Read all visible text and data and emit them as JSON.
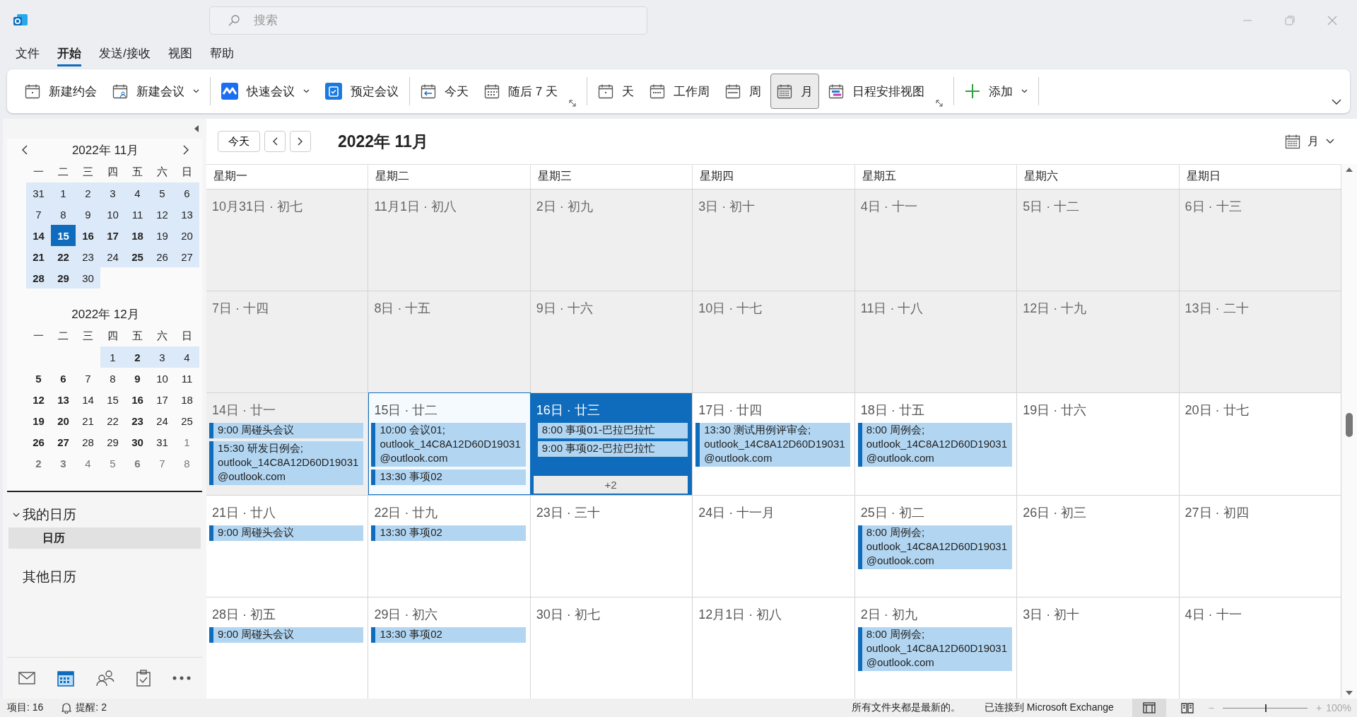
{
  "search": {
    "placeholder": "搜索"
  },
  "menu_tabs": [
    {
      "label": "文件",
      "selected": false
    },
    {
      "label": "开始",
      "selected": true
    },
    {
      "label": "发送/接收",
      "selected": false
    },
    {
      "label": "视图",
      "selected": false
    },
    {
      "label": "帮助",
      "selected": false
    }
  ],
  "ribbon": {
    "groups": [
      [
        {
          "kind": "appointment",
          "label": "新建约会",
          "has_menu": false,
          "launcher": false,
          "selected": false
        },
        {
          "kind": "meeting",
          "label": "新建会议",
          "has_menu": true,
          "launcher": false,
          "selected": false
        }
      ],
      [
        {
          "kind": "quickmeet",
          "label": "快速会议",
          "has_menu": true,
          "launcher": false,
          "selected": false
        },
        {
          "kind": "booking",
          "label": "预定会议",
          "has_menu": false,
          "launcher": false,
          "selected": false
        }
      ],
      [
        {
          "kind": "today",
          "label": "今天",
          "has_menu": false,
          "launcher": false,
          "selected": false
        },
        {
          "kind": "next7",
          "label": "随后 7 天",
          "has_menu": false,
          "launcher": true,
          "selected": false
        }
      ],
      [
        {
          "kind": "day",
          "label": "天",
          "has_menu": false,
          "launcher": false,
          "selected": false
        },
        {
          "kind": "workweek",
          "label": "工作周",
          "has_menu": false,
          "launcher": false,
          "selected": false
        },
        {
          "kind": "week",
          "label": "周",
          "has_menu": false,
          "launcher": false,
          "selected": false
        },
        {
          "kind": "month",
          "label": "月",
          "has_menu": false,
          "launcher": false,
          "selected": true
        },
        {
          "kind": "schedule",
          "label": "日程安排视图",
          "has_menu": false,
          "launcher": true,
          "selected": false
        }
      ],
      [
        {
          "kind": "add",
          "label": "添加",
          "has_menu": true,
          "launcher": false,
          "selected": false
        }
      ]
    ]
  },
  "mini_calendars": [
    {
      "title": "2022年 11月",
      "weekdays": [
        "一",
        "二",
        "三",
        "四",
        "五",
        "六",
        "日"
      ],
      "weeks": [
        [
          {
            "label": "31",
            "bold": false,
            "highlighted": true,
            "selected": false,
            "muted": false
          },
          {
            "label": "1",
            "bold": false,
            "highlighted": true,
            "selected": false,
            "muted": false
          },
          {
            "label": "2",
            "bold": false,
            "highlighted": true,
            "selected": false,
            "muted": false
          },
          {
            "label": "3",
            "bold": false,
            "highlighted": true,
            "selected": false,
            "muted": false
          },
          {
            "label": "4",
            "bold": false,
            "highlighted": true,
            "selected": false,
            "muted": false
          },
          {
            "label": "5",
            "bold": false,
            "highlighted": true,
            "selected": false,
            "muted": false
          },
          {
            "label": "6",
            "bold": false,
            "highlighted": true,
            "selected": false,
            "muted": false
          }
        ],
        [
          {
            "label": "7",
            "bold": false,
            "highlighted": true,
            "selected": false,
            "muted": false
          },
          {
            "label": "8",
            "bold": false,
            "highlighted": true,
            "selected": false,
            "muted": false
          },
          {
            "label": "9",
            "bold": false,
            "highlighted": true,
            "selected": false,
            "muted": false
          },
          {
            "label": "10",
            "bold": false,
            "highlighted": true,
            "selected": false,
            "muted": false
          },
          {
            "label": "11",
            "bold": false,
            "highlighted": true,
            "selected": false,
            "muted": false
          },
          {
            "label": "12",
            "bold": false,
            "highlighted": true,
            "selected": false,
            "muted": false
          },
          {
            "label": "13",
            "bold": false,
            "highlighted": true,
            "selected": false,
            "muted": false
          }
        ],
        [
          {
            "label": "14",
            "bold": true,
            "highlighted": true,
            "selected": false,
            "muted": false
          },
          {
            "label": "15",
            "bold": true,
            "highlighted": true,
            "selected": true,
            "muted": false
          },
          {
            "label": "16",
            "bold": true,
            "highlighted": true,
            "selected": false,
            "muted": false
          },
          {
            "label": "17",
            "bold": true,
            "highlighted": true,
            "selected": false,
            "muted": false
          },
          {
            "label": "18",
            "bold": true,
            "highlighted": true,
            "selected": false,
            "muted": false
          },
          {
            "label": "19",
            "bold": false,
            "highlighted": true,
            "selected": false,
            "muted": false
          },
          {
            "label": "20",
            "bold": false,
            "highlighted": true,
            "selected": false,
            "muted": false
          }
        ],
        [
          {
            "label": "21",
            "bold": true,
            "highlighted": true,
            "selected": false,
            "muted": false
          },
          {
            "label": "22",
            "bold": true,
            "highlighted": true,
            "selected": false,
            "muted": false
          },
          {
            "label": "23",
            "bold": false,
            "highlighted": true,
            "selected": false,
            "muted": false
          },
          {
            "label": "24",
            "bold": false,
            "highlighted": true,
            "selected": false,
            "muted": false
          },
          {
            "label": "25",
            "bold": true,
            "highlighted": true,
            "selected": false,
            "muted": false
          },
          {
            "label": "26",
            "bold": false,
            "highlighted": true,
            "selected": false,
            "muted": false
          },
          {
            "label": "27",
            "bold": false,
            "highlighted": true,
            "selected": false,
            "muted": false
          }
        ],
        [
          {
            "label": "28",
            "bold": true,
            "highlighted": true,
            "selected": false,
            "muted": false
          },
          {
            "label": "29",
            "bold": true,
            "highlighted": true,
            "selected": false,
            "muted": false
          },
          {
            "label": "30",
            "bold": false,
            "highlighted": true,
            "selected": false,
            "muted": false
          }
        ]
      ]
    },
    {
      "title": "2022年 12月",
      "weekdays": [
        "一",
        "二",
        "三",
        "四",
        "五",
        "六",
        "日"
      ],
      "weeks": [
        [
          {
            "label": "1",
            "bold": false,
            "highlighted": true,
            "selected": false,
            "muted": false
          },
          {
            "label": "2",
            "bold": true,
            "highlighted": true,
            "selected": false,
            "muted": false
          },
          {
            "label": "3",
            "bold": false,
            "highlighted": true,
            "selected": false,
            "muted": false
          },
          {
            "label": "4",
            "bold": false,
            "highlighted": true,
            "selected": false,
            "muted": false
          }
        ],
        [
          {
            "label": "5",
            "bold": true,
            "highlighted": false,
            "selected": false,
            "muted": false
          },
          {
            "label": "6",
            "bold": true,
            "highlighted": false,
            "selected": false,
            "muted": false
          },
          {
            "label": "7",
            "bold": false,
            "highlighted": false,
            "selected": false,
            "muted": false
          },
          {
            "label": "8",
            "bold": false,
            "highlighted": false,
            "selected": false,
            "muted": false
          },
          {
            "label": "9",
            "bold": true,
            "highlighted": false,
            "selected": false,
            "muted": false
          },
          {
            "label": "10",
            "bold": false,
            "highlighted": false,
            "selected": false,
            "muted": false
          },
          {
            "label": "11",
            "bold": false,
            "highlighted": false,
            "selected": false,
            "muted": false
          }
        ],
        [
          {
            "label": "12",
            "bold": true,
            "highlighted": false,
            "selected": false,
            "muted": false
          },
          {
            "label": "13",
            "bold": true,
            "highlighted": false,
            "selected": false,
            "muted": false
          },
          {
            "label": "14",
            "bold": false,
            "highlighted": false,
            "selected": false,
            "muted": false
          },
          {
            "label": "15",
            "bold": false,
            "highlighted": false,
            "selected": false,
            "muted": false
          },
          {
            "label": "16",
            "bold": true,
            "highlighted": false,
            "selected": false,
            "muted": false
          },
          {
            "label": "17",
            "bold": false,
            "highlighted": false,
            "selected": false,
            "muted": false
          },
          {
            "label": "18",
            "bold": false,
            "highlighted": false,
            "selected": false,
            "muted": false
          }
        ],
        [
          {
            "label": "19",
            "bold": true,
            "highlighted": false,
            "selected": false,
            "muted": false
          },
          {
            "label": "20",
            "bold": true,
            "highlighted": false,
            "selected": false,
            "muted": false
          },
          {
            "label": "21",
            "bold": false,
            "highlighted": false,
            "selected": false,
            "muted": false
          },
          {
            "label": "22",
            "bold": false,
            "highlighted": false,
            "selected": false,
            "muted": false
          },
          {
            "label": "23",
            "bold": true,
            "highlighted": false,
            "selected": false,
            "muted": false
          },
          {
            "label": "24",
            "bold": false,
            "highlighted": false,
            "selected": false,
            "muted": false
          },
          {
            "label": "25",
            "bold": false,
            "highlighted": false,
            "selected": false,
            "muted": false
          }
        ],
        [
          {
            "label": "26",
            "bold": true,
            "highlighted": false,
            "selected": false,
            "muted": false
          },
          {
            "label": "27",
            "bold": true,
            "highlighted": false,
            "selected": false,
            "muted": false
          },
          {
            "label": "28",
            "bold": false,
            "highlighted": false,
            "selected": false,
            "muted": false
          },
          {
            "label": "29",
            "bold": false,
            "highlighted": false,
            "selected": false,
            "muted": false
          },
          {
            "label": "30",
            "bold": true,
            "highlighted": false,
            "selected": false,
            "muted": false
          },
          {
            "label": "31",
            "bold": false,
            "highlighted": false,
            "selected": false,
            "muted": false
          },
          {
            "label": "1",
            "bold": false,
            "highlighted": false,
            "selected": false,
            "muted": true
          }
        ],
        [
          {
            "label": "2",
            "bold": true,
            "highlighted": false,
            "selected": false,
            "muted": true
          },
          {
            "label": "3",
            "bold": true,
            "highlighted": false,
            "selected": false,
            "muted": true
          },
          {
            "label": "4",
            "bold": false,
            "highlighted": false,
            "selected": false,
            "muted": true
          },
          {
            "label": "5",
            "bold": false,
            "highlighted": false,
            "selected": false,
            "muted": true
          },
          {
            "label": "6",
            "bold": true,
            "highlighted": false,
            "selected": false,
            "muted": true
          },
          {
            "label": "7",
            "bold": false,
            "highlighted": false,
            "selected": false,
            "muted": true
          },
          {
            "label": "8",
            "bold": false,
            "highlighted": false,
            "selected": false,
            "muted": true
          }
        ]
      ]
    }
  ],
  "folder_groups": [
    {
      "label": "我的日历",
      "expanded": true,
      "items": [
        {
          "label": "日历",
          "selected": true
        }
      ]
    },
    {
      "label": "其他日历"
    }
  ],
  "nav": [
    {
      "kind": "mail",
      "selected": false
    },
    {
      "kind": "calendar",
      "selected": true
    },
    {
      "kind": "people",
      "selected": false
    },
    {
      "kind": "tasks",
      "selected": false
    },
    {
      "kind": "more",
      "selected": false
    }
  ],
  "calendar": {
    "today_button": "今天",
    "title": "2022年 11月",
    "view_menu": "月",
    "weekdays": [
      "星期一",
      "星期二",
      "星期三",
      "星期四",
      "星期五",
      "星期六",
      "星期日"
    ],
    "weeks": [
      [
        {
          "label": "10月31日 · 初七",
          "past": true,
          "today": false,
          "selected": false
        },
        {
          "label": "11月1日 · 初八",
          "past": true,
          "today": false,
          "selected": false
        },
        {
          "label": "2日 · 初九",
          "past": true,
          "today": false,
          "selected": false
        },
        {
          "label": "3日 · 初十",
          "past": true,
          "today": false,
          "selected": false
        },
        {
          "label": "4日 · 十一",
          "past": true,
          "today": false,
          "selected": false
        },
        {
          "label": "5日 · 十二",
          "past": true,
          "today": false,
          "selected": false
        },
        {
          "label": "6日 · 十三",
          "past": true,
          "today": false,
          "selected": false
        }
      ],
      [
        {
          "label": "7日 · 十四",
          "past": true,
          "today": false,
          "selected": false
        },
        {
          "label": "8日 · 十五",
          "past": true,
          "today": false,
          "selected": false
        },
        {
          "label": "9日 · 十六",
          "past": true,
          "today": false,
          "selected": false
        },
        {
          "label": "10日 · 十七",
          "past": true,
          "today": false,
          "selected": false
        },
        {
          "label": "11日 · 十八",
          "past": true,
          "today": false,
          "selected": false
        },
        {
          "label": "12日 · 十九",
          "past": true,
          "today": false,
          "selected": false
        },
        {
          "label": "13日 · 二十",
          "past": true,
          "today": false,
          "selected": false
        }
      ],
      [
        {
          "label": "14日 · 廿一",
          "past": true,
          "today": false,
          "selected": false,
          "events": [
            {
              "text": "9:00 周碰头会议"
            },
            {
              "text": "15:30 研发日例会;",
              "location": "outlook_14C8A12D60D19031@outlook.com"
            }
          ]
        },
        {
          "label": "15日 · 廿二",
          "past": false,
          "today": true,
          "selected": false,
          "events": [
            {
              "text": "10:00 会议01;",
              "location": "outlook_14C8A12D60D19031@outlook.com"
            },
            {
              "text": "13:30 事项02"
            }
          ]
        },
        {
          "label": "16日 · 廿三",
          "past": false,
          "today": false,
          "selected": true,
          "events": [
            {
              "text": "8:00 事项01-巴拉巴拉忙"
            },
            {
              "text": "9:00 事项02-巴拉巴拉忙"
            }
          ],
          "more": "+2"
        },
        {
          "label": "17日 · 廿四",
          "past": false,
          "today": false,
          "selected": false,
          "events": [
            {
              "text": "13:30 测试用例评审会;",
              "location": "outlook_14C8A12D60D19031@outlook.com"
            }
          ]
        },
        {
          "label": "18日 · 廿五",
          "past": false,
          "today": false,
          "selected": false,
          "events": [
            {
              "text": "8:00 周例会;",
              "location": "outlook_14C8A12D60D19031@outlook.com"
            }
          ]
        },
        {
          "label": "19日 · 廿六",
          "past": false,
          "today": false,
          "selected": false
        },
        {
          "label": "20日 · 廿七",
          "past": false,
          "today": false,
          "selected": false
        }
      ],
      [
        {
          "label": "21日 · 廿八",
          "past": false,
          "today": false,
          "selected": false,
          "events": [
            {
              "text": "9:00 周碰头会议"
            }
          ]
        },
        {
          "label": "22日 · 廿九",
          "past": false,
          "today": false,
          "selected": false,
          "events": [
            {
              "text": "13:30 事项02"
            }
          ]
        },
        {
          "label": "23日 · 三十",
          "past": false,
          "today": false,
          "selected": false
        },
        {
          "label": "24日 · 十一月",
          "past": false,
          "today": false,
          "selected": false
        },
        {
          "label": "25日 · 初二",
          "past": false,
          "today": false,
          "selected": false,
          "events": [
            {
              "text": "8:00 周例会;",
              "location": "outlook_14C8A12D60D19031@outlook.com"
            }
          ]
        },
        {
          "label": "26日 · 初三",
          "past": false,
          "today": false,
          "selected": false
        },
        {
          "label": "27日 · 初四",
          "past": false,
          "today": false,
          "selected": false
        }
      ],
      [
        {
          "label": "28日 · 初五",
          "past": false,
          "today": false,
          "selected": false,
          "events": [
            {
              "text": "9:00 周碰头会议"
            }
          ]
        },
        {
          "label": "29日 · 初六",
          "past": false,
          "today": false,
          "selected": false,
          "events": [
            {
              "text": "13:30 事项02"
            }
          ]
        },
        {
          "label": "30日 · 初七",
          "past": false,
          "today": false,
          "selected": false
        },
        {
          "label": "12月1日 · 初八",
          "past": false,
          "today": false,
          "selected": false
        },
        {
          "label": "2日 · 初九",
          "past": false,
          "today": false,
          "selected": false,
          "events": [
            {
              "text": "8:00 周例会;",
              "location": "outlook_14C8A12D60D19031@outlook.com"
            }
          ]
        },
        {
          "label": "3日 · 初十",
          "past": false,
          "today": false,
          "selected": false
        },
        {
          "label": "4日 · 十一",
          "past": false,
          "today": false,
          "selected": false
        }
      ]
    ]
  },
  "status_bar": {
    "items": "项目: 16",
    "reminders": "提醒: 2",
    "sync": "所有文件夹都是最新的。",
    "connection": "已连接到 Microsoft Exchange",
    "views": [
      {
        "kind": "normal",
        "selected": true
      },
      {
        "kind": "reading",
        "selected": false
      }
    ],
    "zoom": {
      "minus": "−",
      "plus": "+",
      "level": 0.5,
      "reading": "100%"
    }
  }
}
